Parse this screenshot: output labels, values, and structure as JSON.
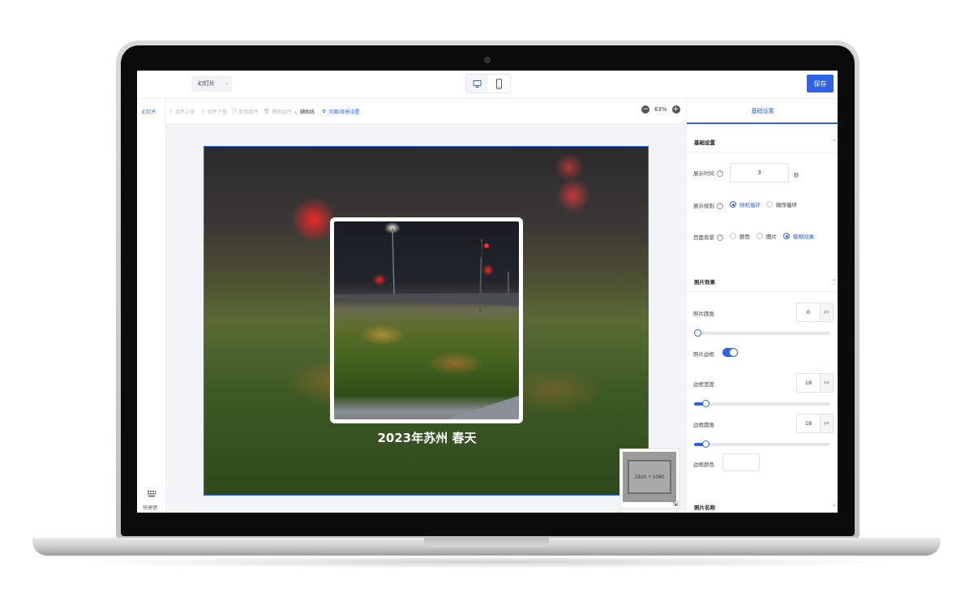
{
  "topbar": {
    "slide_type": "幻灯片",
    "save_label": "保存"
  },
  "left_rail": {
    "tab_label": "幻灯片",
    "shortcut_label": "快捷键"
  },
  "toolbar": {
    "move_up": "组件上移",
    "move_down": "组件下移",
    "copy": "复制组件",
    "delete": "删除组件",
    "guides": "辅助线",
    "page_bg": "页面/背景设置",
    "zoom": "63%"
  },
  "canvas": {
    "caption": "2023年苏州 春天",
    "minimap_size": "1920 * 1080"
  },
  "panel": {
    "tab": "基础设置",
    "basic": {
      "title": "基础设置",
      "display_time_label": "展示时间",
      "display_time_value": "3",
      "display_time_unit": "秒",
      "display_rule_label": "展示规则",
      "rule_random": "随机循环",
      "rule_sequence": "顺序循环",
      "page_bg_label": "页面背景",
      "bg_color": "颜色",
      "bg_image": "图片",
      "bg_blur": "模糊效果"
    },
    "photo_effect": {
      "title": "照片效果",
      "corner_label": "照片圆角",
      "corner_value": "0",
      "corner_unit": "px",
      "corner_level": 0,
      "border_label": "照片边框",
      "border_on": true,
      "border_width_label": "边框宽度",
      "border_width_value": "18",
      "border_width_unit": "px",
      "border_width_level": 0.06,
      "border_radius_label": "边框圆角",
      "border_radius_value": "18",
      "border_radius_unit": "px",
      "border_radius_level": 0.06,
      "border_color_label": "边框颜色"
    },
    "photo_name": {
      "title": "照片名称"
    }
  },
  "colors": {
    "accent": "#2d63ea"
  }
}
